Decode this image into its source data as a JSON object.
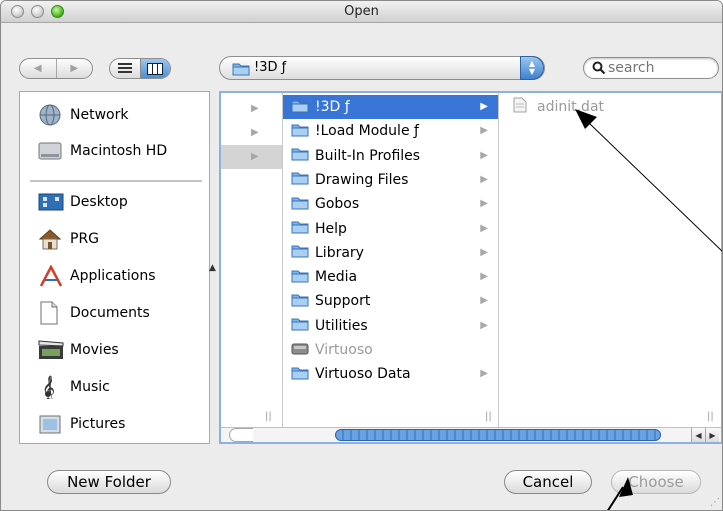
{
  "window": {
    "title": "Open"
  },
  "toolbar": {
    "back_glyph": "◀",
    "forward_glyph": "▶",
    "path_label": "!3D ƒ",
    "search_placeholder": "search"
  },
  "sidebar": {
    "devices": [
      {
        "label": "Network",
        "icon": "network-globe-icon"
      },
      {
        "label": "Macintosh HD",
        "icon": "hard-drive-icon"
      }
    ],
    "places": [
      {
        "label": "Desktop",
        "icon": "desktop-icon"
      },
      {
        "label": "PRG",
        "icon": "home-icon"
      },
      {
        "label": "Applications",
        "icon": "applications-icon"
      },
      {
        "label": "Documents",
        "icon": "documents-icon"
      },
      {
        "label": "Movies",
        "icon": "movies-icon"
      },
      {
        "label": "Music",
        "icon": "music-icon"
      },
      {
        "label": "Pictures",
        "icon": "pictures-icon"
      }
    ]
  },
  "browser": {
    "column2": [
      {
        "label": "!3D ƒ",
        "selected": true,
        "has_children": true,
        "enabled": true
      },
      {
        "label": "!Load Module ƒ",
        "selected": false,
        "has_children": true,
        "enabled": true
      },
      {
        "label": "Built-In Profiles",
        "selected": false,
        "has_children": true,
        "enabled": true
      },
      {
        "label": "Drawing Files",
        "selected": false,
        "has_children": true,
        "enabled": true
      },
      {
        "label": "Gobos",
        "selected": false,
        "has_children": true,
        "enabled": true
      },
      {
        "label": "Help",
        "selected": false,
        "has_children": true,
        "enabled": true
      },
      {
        "label": "Library",
        "selected": false,
        "has_children": true,
        "enabled": true
      },
      {
        "label": "Media",
        "selected": false,
        "has_children": true,
        "enabled": true
      },
      {
        "label": "Support",
        "selected": false,
        "has_children": true,
        "enabled": true
      },
      {
        "label": "Utilities",
        "selected": false,
        "has_children": true,
        "enabled": true
      },
      {
        "label": "Virtuoso",
        "selected": false,
        "has_children": false,
        "enabled": false
      },
      {
        "label": "Virtuoso Data",
        "selected": false,
        "has_children": true,
        "enabled": true
      }
    ],
    "column3": [
      {
        "label": "adinit.dat",
        "enabled": false
      }
    ]
  },
  "buttons": {
    "new_folder": "New Folder",
    "cancel": "Cancel",
    "choose": "Choose"
  },
  "colors": {
    "selection": "#3875d7",
    "focus_ring": "#8cb1de",
    "close_button_green": "#4ab81c"
  }
}
